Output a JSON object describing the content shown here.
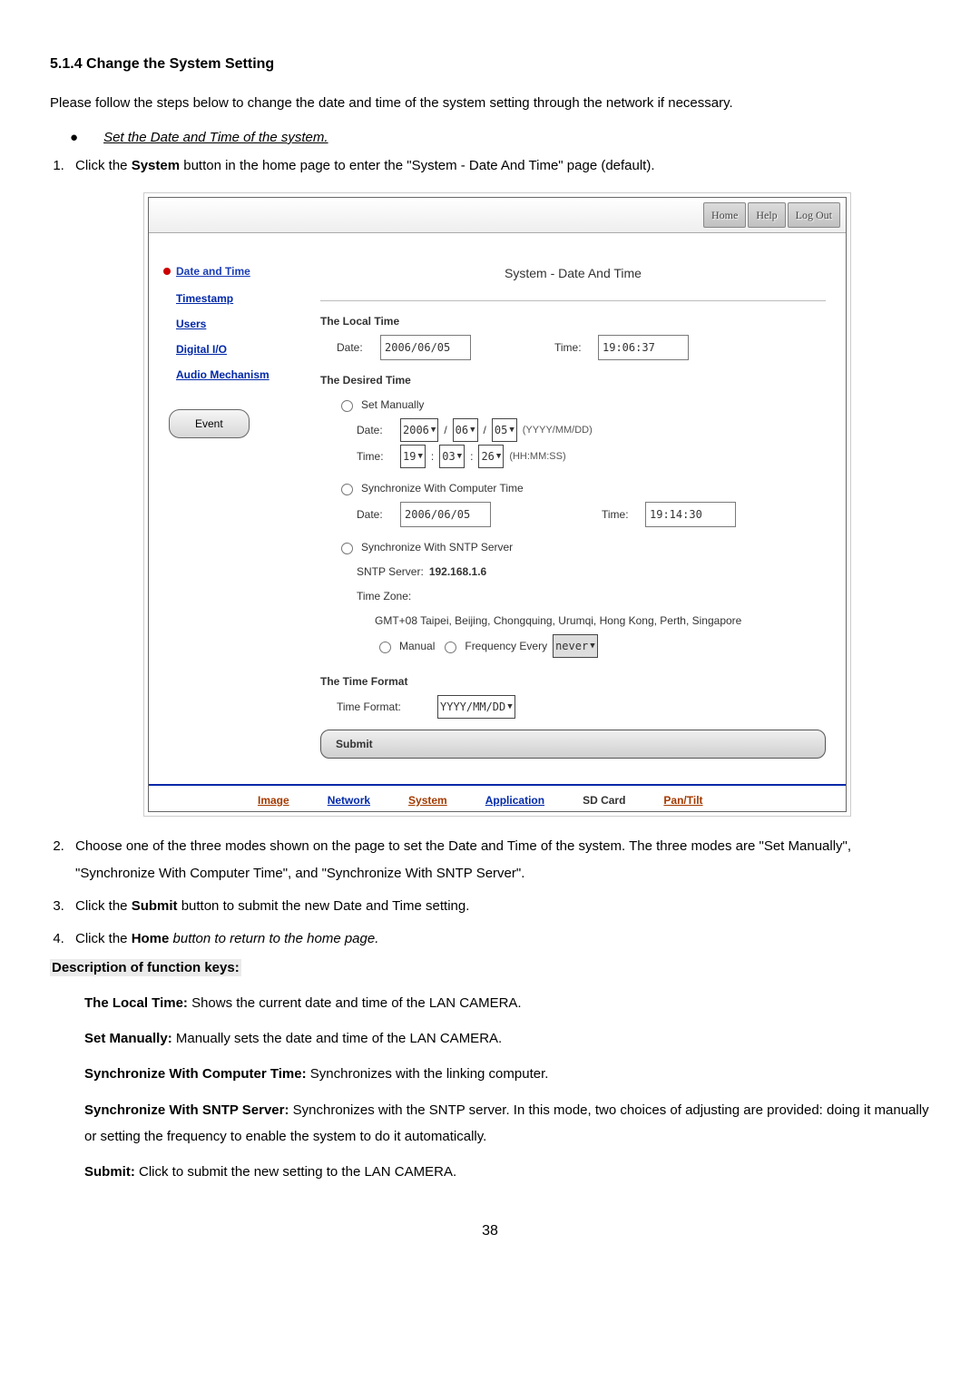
{
  "heading": "5.1.4  Change the System Setting",
  "intro": "Please follow the steps below to change the date and time of the system setting through the network if necessary.",
  "bullet": "Set the Date and Time of the system.",
  "steps": {
    "s1_pre": "Click the ",
    "s1_b": "System",
    "s1_post": " button in the home page to enter the \"System - Date And Time\" page (default).",
    "s2": "Choose one of the three modes shown on the page to set the Date and Time of the system. The three modes are \"Set Manually\", \"Synchronize With Computer Time\", and \"Synchronize With SNTP Server\".",
    "s3_pre": "Click the ",
    "s3_b": "Submit",
    "s3_post": " button to submit the new Date and Time setting.",
    "s4_pre": "Click the ",
    "s4_b": "Home",
    "s4_post": " button to return to the home page."
  },
  "screenshot": {
    "topbuttons": {
      "home": "Home",
      "help": "Help",
      "logout": "Log Out"
    },
    "sidebar": {
      "active": "Date and Time",
      "timestamp": "Timestamp",
      "users": "Users",
      "digitalio": "Digital I/O",
      "audio": "Audio Mechanism",
      "event": "Event"
    },
    "title": "System - Date And Time",
    "localTimeLabel": "The Local Time",
    "local": {
      "date_lbl": "Date:",
      "date": "2006/06/05",
      "time_lbl": "Time:",
      "time": "19:06:37"
    },
    "desiredLabel": "The Desired Time",
    "modeManual": "Set Manually",
    "manual": {
      "date_lbl": "Date:",
      "yyyy": "2006",
      "mm": "06",
      "dd": "05",
      "date_hint": "(YYYY/MM/DD)",
      "time_lbl": "Time:",
      "hh": "19",
      "mi": "03",
      "ss": "26",
      "time_hint": "(HH:MM:SS)"
    },
    "modeComputer": "Synchronize With Computer Time",
    "computer": {
      "date_lbl": "Date:",
      "date": "2006/06/05",
      "time_lbl": "Time:",
      "time": "19:14:30"
    },
    "modeSntp": "Synchronize With SNTP Server",
    "sntp": {
      "server_lbl": "SNTP Server:",
      "server": "192.168.1.6",
      "tz_lbl": "Time Zone:",
      "tz": "GMT+08 Taipei, Beijing, Chongquing, Urumqi, Hong Kong, Perth, Singapore",
      "manual_lbl": "Manual",
      "freq_lbl": "Frequency Every",
      "freq_value": "never"
    },
    "formatLabel": "The Time Format",
    "format_row_lbl": "Time Format:",
    "format_value": "YYYY/MM/DD",
    "submit": "Submit",
    "bottomnav": {
      "image": "Image",
      "network": "Network",
      "system": "System",
      "application": "Application",
      "sdcard": "SD Card",
      "pantilt": "Pan/Tilt"
    }
  },
  "desc_heading": "Description of function keys:",
  "desc": {
    "local_b": "The Local Time:",
    "local_t": " Shows the current date and time of the LAN CAMERA.",
    "manual_b": "Set Manually:",
    "manual_t": " Manually sets the date and time of the LAN CAMERA.",
    "comp_b": "Synchronize With Computer Time:",
    "comp_t": " Synchronizes with the linking computer.",
    "sntp_b": "Synchronize With SNTP Server:",
    "sntp_t": " Synchronizes with the SNTP server. In this mode, two choices of adjusting are provided: doing it manually or setting the frequency to enable the system to do it automatically.",
    "submit_b": "Submit:",
    "submit_t": " Click to submit the new setting to the LAN CAMERA."
  },
  "page_number": "38"
}
